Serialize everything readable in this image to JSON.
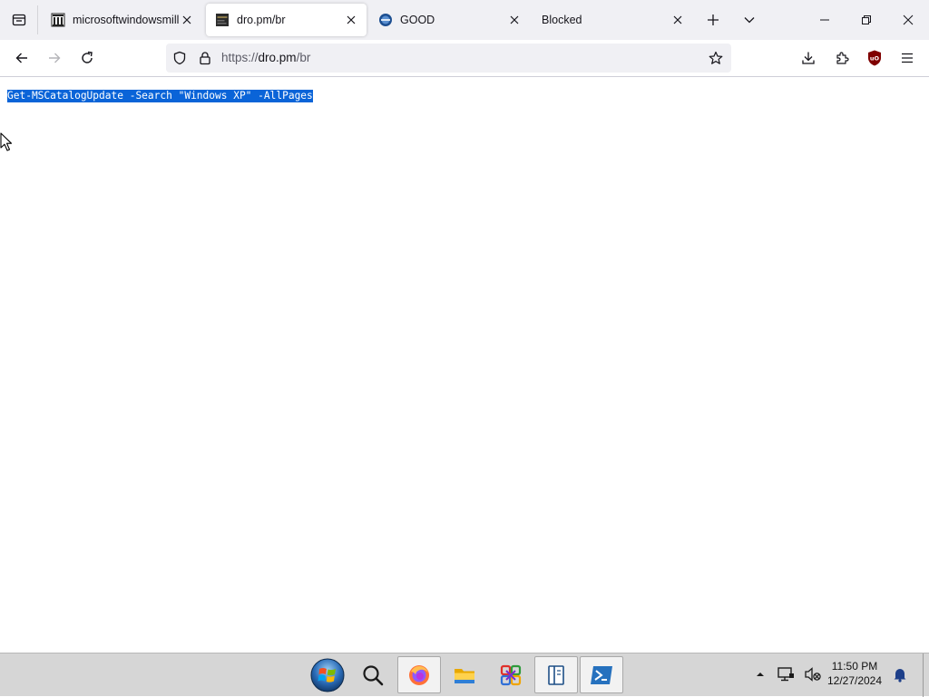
{
  "browser": {
    "tabs": [
      {
        "title": "microsoftwindowsmill",
        "favicon": "archive-org-icon",
        "active": false
      },
      {
        "title": "dro.pm/br",
        "favicon": "dro-pm-icon",
        "active": true
      },
      {
        "title": "GOOD",
        "favicon": "good-site-icon",
        "active": false
      },
      {
        "title": "Blocked",
        "favicon": "",
        "active": false
      }
    ],
    "url": {
      "scheme": "https://",
      "host": "dro.pm",
      "path": "/br"
    },
    "icons": {
      "list_all_tabs": "tab-list-icon",
      "new_tab": "plus-icon",
      "tab_overflow": "chevron-down-icon",
      "back": "back-arrow-icon",
      "forward": "forward-arrow-icon",
      "reload": "reload-icon",
      "tracking_protection": "shield-icon",
      "lock": "lock-icon",
      "bookmark": "star-icon",
      "downloads": "download-icon",
      "extensions": "puzzle-icon",
      "ublock": "ublock-origin-icon",
      "menu": "hamburger-menu-icon"
    }
  },
  "page": {
    "text": "Get-MSCatalogUpdate -Search \"Windows XP\" -AllPages",
    "selected": true
  },
  "taskbar": {
    "apps": [
      {
        "name": "start-button",
        "icon": "windows-orb-icon"
      },
      {
        "name": "search",
        "icon": "search-icon"
      },
      {
        "name": "firefox",
        "icon": "firefox-icon",
        "running": true
      },
      {
        "name": "file-explorer",
        "icon": "folder-icon"
      },
      {
        "name": "app-4",
        "icon": "colorful-app-icon"
      },
      {
        "name": "app-5",
        "icon": "book-icon",
        "running": true
      },
      {
        "name": "powershell",
        "icon": "powershell-icon",
        "running": true
      }
    ],
    "tray": {
      "time": "11:50 PM",
      "date": "12/27/2024"
    }
  },
  "colors": {
    "selection": "#0a64d8",
    "tabstrip": "#f0f0f4",
    "taskbar": "#d6d6d6",
    "ublock_red": "#800000"
  }
}
